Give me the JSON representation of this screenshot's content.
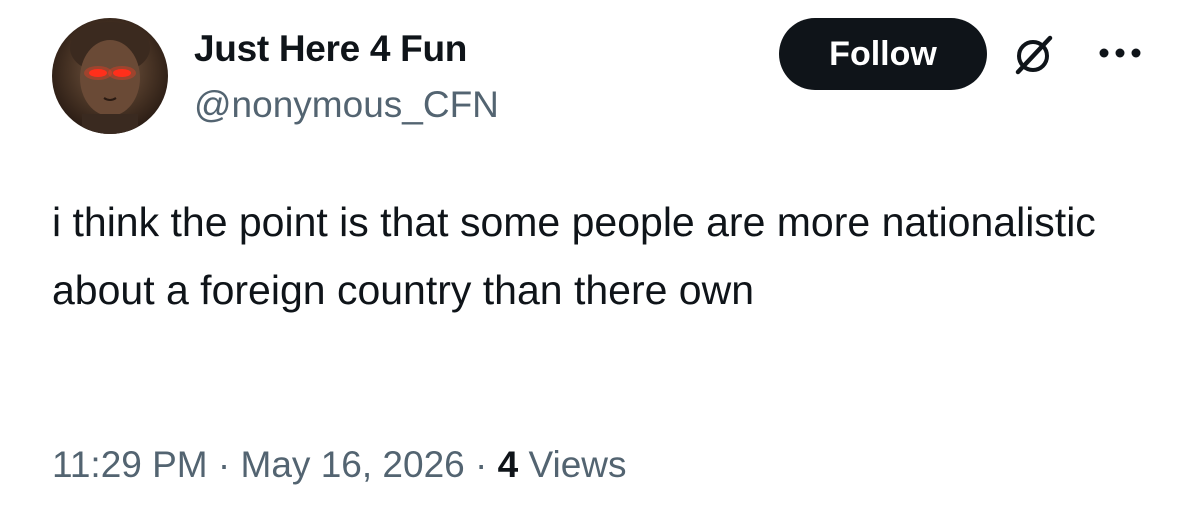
{
  "author": {
    "display_name": "Just Here 4 Fun",
    "handle": "@nonymous_CFN",
    "avatar_icon": "avatar-image"
  },
  "actions": {
    "follow_label": "Follow",
    "grok_icon": "grok-icon",
    "more_icon": "more-icon"
  },
  "tweet": {
    "text": "i think the point is that some people are more nationalistic about a foreign country than there own"
  },
  "meta": {
    "time": "11:29 PM",
    "separator": "·",
    "date": "May 16, 2026",
    "views_count": "4",
    "views_label": "Views"
  },
  "colors": {
    "text_primary": "#0f1419",
    "text_secondary": "#536471",
    "button_bg": "#0f1419",
    "button_text": "#ffffff",
    "background": "#ffffff"
  }
}
